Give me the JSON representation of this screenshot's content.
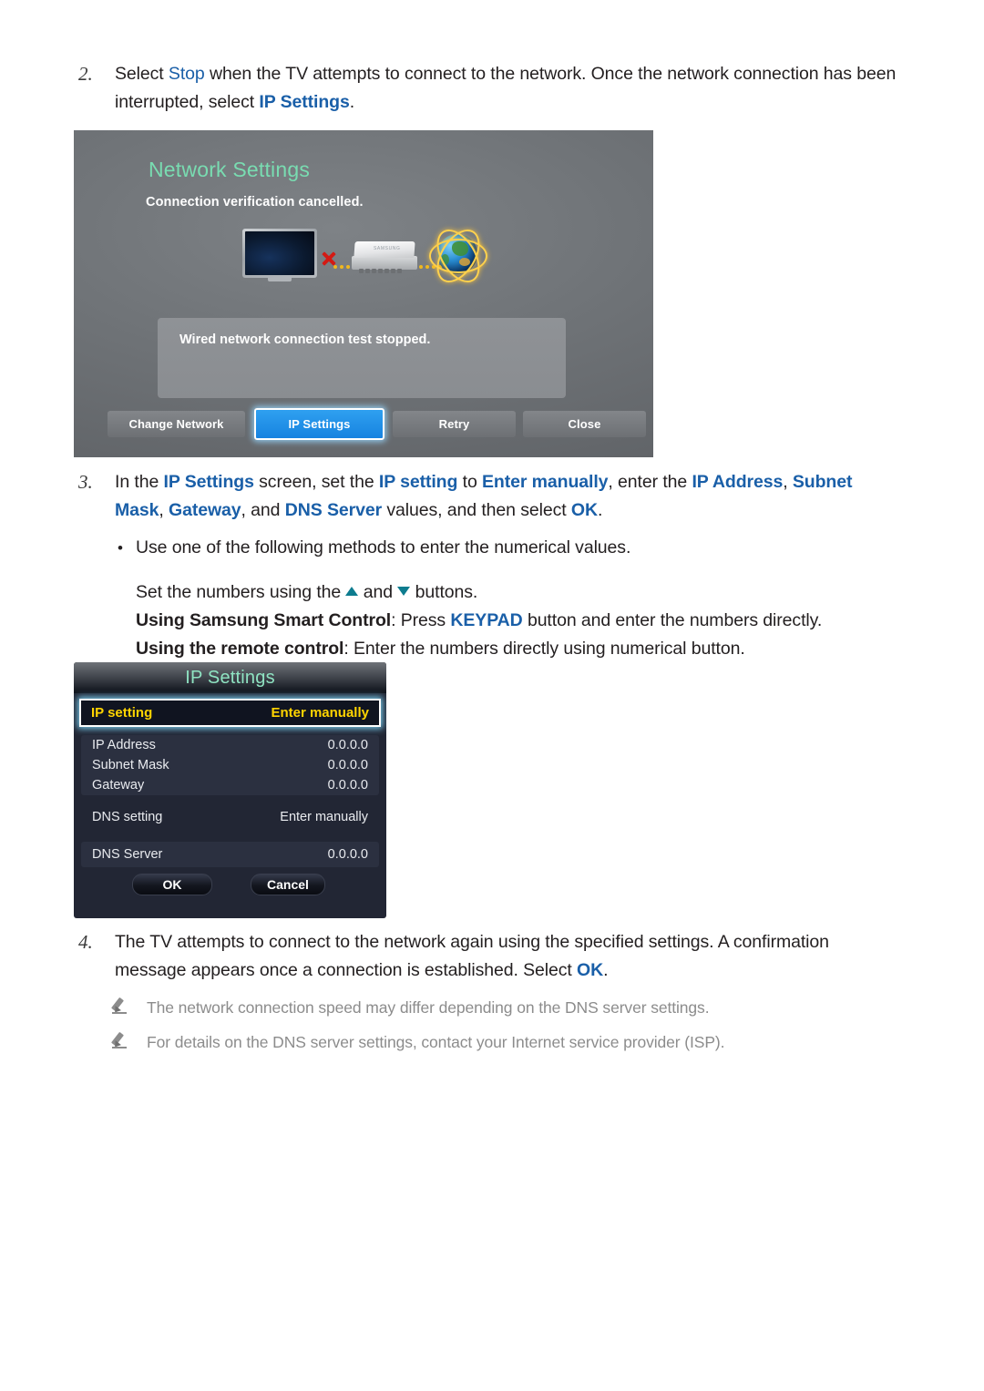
{
  "document": {
    "steps": [
      {
        "number": "2.",
        "segments": [
          {
            "t": "Select ",
            "s": "plain"
          },
          {
            "t": "Stop",
            "s": "hl"
          },
          {
            "t": " when the TV attempts to connect to the network. Once the network connection has been interrupted, select ",
            "s": "plain"
          },
          {
            "t": "IP Settings",
            "s": "hl-b"
          },
          {
            "t": ".",
            "s": "plain"
          }
        ]
      },
      {
        "number": "3.",
        "segments": [
          {
            "t": "In the ",
            "s": "plain"
          },
          {
            "t": "IP Settings",
            "s": "hl-b"
          },
          {
            "t": " screen, set the ",
            "s": "plain"
          },
          {
            "t": "IP setting",
            "s": "hl-b"
          },
          {
            "t": " to ",
            "s": "plain"
          },
          {
            "t": "Enter manually",
            "s": "hl-b"
          },
          {
            "t": ", enter the ",
            "s": "plain"
          },
          {
            "t": "IP Address",
            "s": "hl-b"
          },
          {
            "t": ", ",
            "s": "plain"
          },
          {
            "t": "Subnet Mask",
            "s": "hl-b"
          },
          {
            "t": ", ",
            "s": "plain"
          },
          {
            "t": "Gateway",
            "s": "hl-b"
          },
          {
            "t": ", and ",
            "s": "plain"
          },
          {
            "t": "DNS Server",
            "s": "hl-b"
          },
          {
            "t": " values, and then select ",
            "s": "plain"
          },
          {
            "t": "OK",
            "s": "hl-b"
          },
          {
            "t": ".",
            "s": "plain"
          }
        ]
      },
      {
        "number": "4.",
        "segments": [
          {
            "t": "The TV attempts to connect to the network again using the specified settings. A confirmation message appears once a connection is established. Select ",
            "s": "plain"
          },
          {
            "t": "OK",
            "s": "hl-b"
          },
          {
            "t": ".",
            "s": "plain"
          }
        ]
      }
    ],
    "bullet": {
      "marker": "•",
      "line1": "Use one of the following methods to enter the numerical values.",
      "line2_pre": "Set the numbers using the ",
      "line2_mid": " and ",
      "line2_post": " buttons.",
      "line3_label": "Using Samsung Smart Control",
      "line3_pre": ": Press ",
      "line3_key": "KEYPAD",
      "line3_post": " button and enter the numbers directly.",
      "line4_label": "Using the remote control",
      "line4_post": ": Enter the numbers directly using numerical button."
    },
    "notes": [
      {
        "icon": "pencil-icon",
        "text": "The network connection speed may differ depending on the DNS server settings."
      },
      {
        "icon": "pencil-icon",
        "text": "For details on the DNS server settings, contact your Internet service provider (ISP)."
      }
    ]
  },
  "network_settings_screen": {
    "title": "Network Settings",
    "subtitle": "Connection verification cancelled.",
    "diagram": {
      "tv_icon": "tv-device-icon",
      "error_icon": "red-x-icon",
      "router_icon": "router-device-icon",
      "router_brand": "SAMSUNG",
      "internet_icon": "globe-internet-icon"
    },
    "message": "Wired network connection test stopped.",
    "buttons": [
      {
        "label": "Change Network",
        "selected": false
      },
      {
        "label": "IP Settings",
        "selected": true
      },
      {
        "label": "Retry",
        "selected": false
      },
      {
        "label": "Close",
        "selected": false
      }
    ]
  },
  "ip_settings_screen": {
    "title": "IP Settings",
    "selected_row": {
      "label": "IP setting",
      "value": "Enter manually"
    },
    "ip_group": [
      {
        "label": "IP Address",
        "value": "0.0.0.0"
      },
      {
        "label": "Subnet Mask",
        "value": "0.0.0.0"
      },
      {
        "label": "Gateway",
        "value": "0.0.0.0"
      }
    ],
    "dns_setting": {
      "label": "DNS setting",
      "value": "Enter manually"
    },
    "dns_server": {
      "label": "DNS Server",
      "value": "0.0.0.0"
    },
    "buttons": [
      {
        "label": "OK"
      },
      {
        "label": "Cancel"
      }
    ]
  },
  "colors": {
    "link_blue": "#1a5fa8",
    "tv_title_green": "#79dcb1",
    "selected_button_blue": "#1783e0",
    "selected_row_yellow": "#ffd400",
    "note_gray": "#8c8c8c",
    "arrow_teal": "#0d7c8f"
  }
}
